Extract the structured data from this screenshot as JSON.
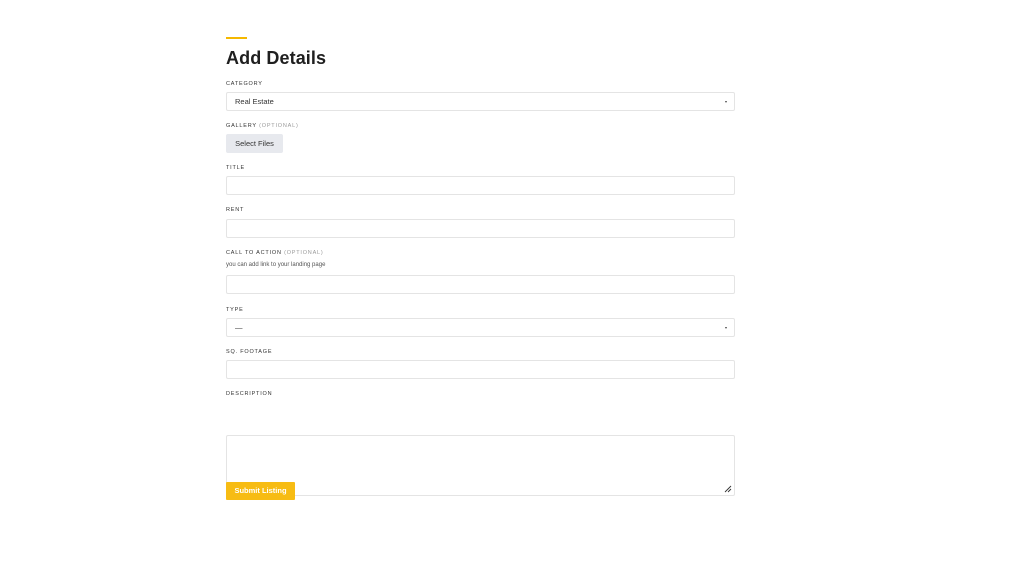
{
  "form": {
    "title": "Add Details",
    "category": {
      "label": "Category",
      "value": "Real Estate"
    },
    "gallery": {
      "label": "Gallery",
      "optional": "(Optional)",
      "button": "Select Files"
    },
    "title_field": {
      "label": "Title",
      "value": ""
    },
    "rent": {
      "label": "Rent",
      "value": ""
    },
    "cta": {
      "label": "Call to Action",
      "optional": "(Optional)",
      "hint": "you can add link to your landing page",
      "value": ""
    },
    "type": {
      "label": "Type",
      "value": "—"
    },
    "sq_footage": {
      "label": "Sq. Footage",
      "value": ""
    },
    "description": {
      "label": "Description",
      "value": ""
    },
    "submit": "Submit Listing"
  },
  "colors": {
    "accent": "#f5b800",
    "submit_bg": "#f7bc13",
    "border": "#e4e4e4"
  },
  "icons": {
    "select_caret": "caret-down-icon",
    "resize": "resize-handle-icon"
  }
}
